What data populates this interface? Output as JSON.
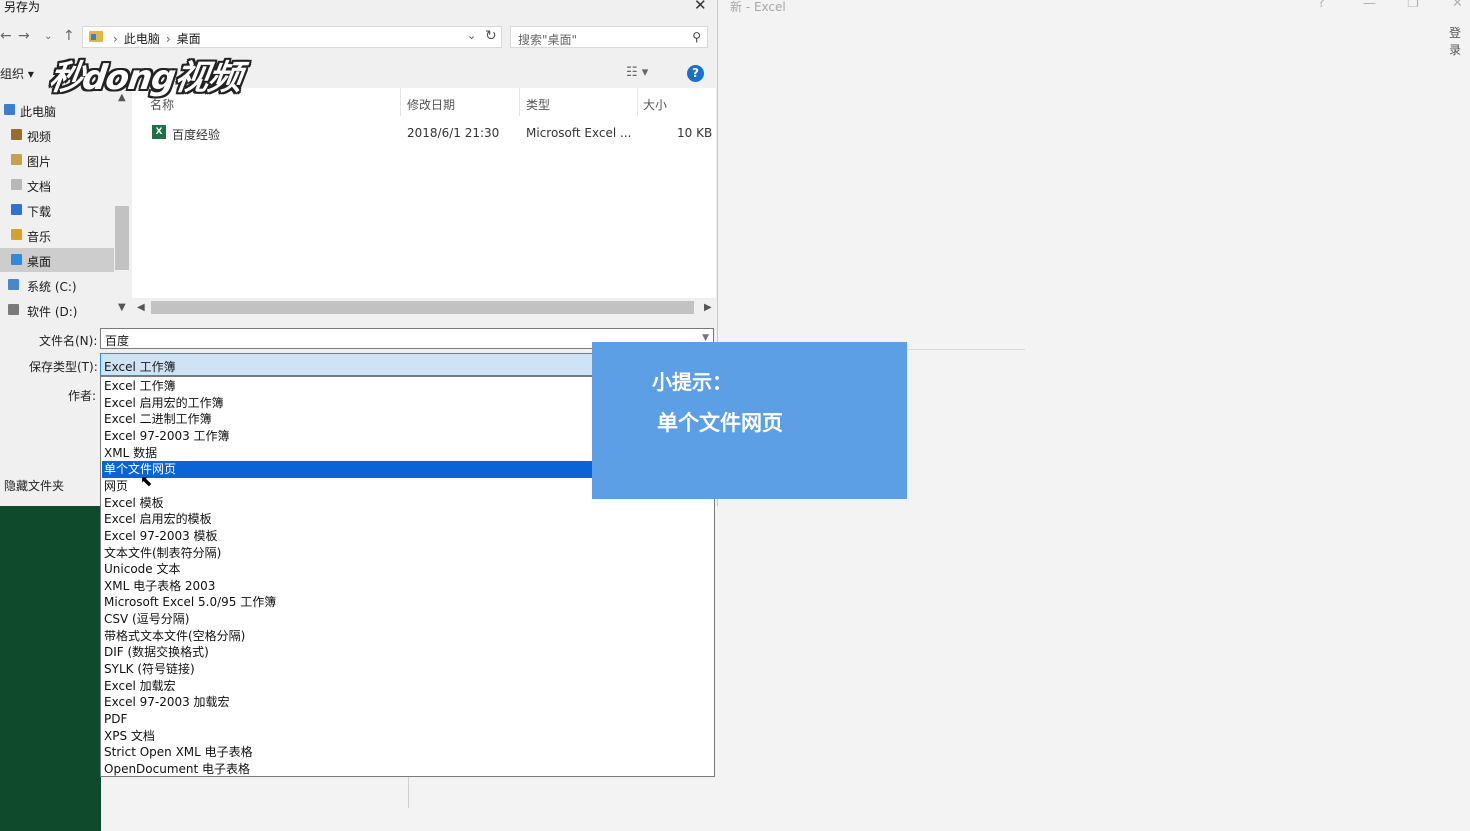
{
  "excel_window": {
    "title": "新 - Excel",
    "login": "登录",
    "help_label": "?"
  },
  "dialog": {
    "title": "另存为",
    "breadcrumb": [
      "此电脑",
      "桌面"
    ],
    "search_placeholder": "搜索\"桌面\"",
    "organize_label": "组织 ▾",
    "help_icon_text": "?",
    "watermark": "秒dong视频",
    "nav_items": [
      {
        "label": "此电脑",
        "icon": "computer-icon",
        "color": "#3d7dd1"
      },
      {
        "label": "视频",
        "icon": "video-folder-icon",
        "color": "#9a6b2a"
      },
      {
        "label": "图片",
        "icon": "pictures-folder-icon",
        "color": "#c8a04e"
      },
      {
        "label": "文档",
        "icon": "documents-folder-icon",
        "color": "#b8b8b8"
      },
      {
        "label": "下载",
        "icon": "downloads-folder-icon",
        "color": "#2c74d1"
      },
      {
        "label": "音乐",
        "icon": "music-folder-icon",
        "color": "#d8a12c"
      },
      {
        "label": "桌面",
        "icon": "desktop-folder-icon",
        "color": "#2c8ae0",
        "selected": true
      },
      {
        "label": "系统 (C:)",
        "icon": "drive-c-icon",
        "color": "#4a86c8"
      },
      {
        "label": "软件 (D:)",
        "icon": "drive-d-icon",
        "color": "#7a7a7a"
      }
    ],
    "columns": [
      "名称",
      "修改日期",
      "类型",
      "大小"
    ],
    "files": [
      {
        "name": "百度经验",
        "modified": "2018/6/1 21:30",
        "type": "Microsoft Excel ...",
        "size": "10 KB",
        "icon": "excel-file-icon"
      }
    ],
    "filename_label": "文件名(N):",
    "filename_value": "百度",
    "savetype_label": "保存类型(T):",
    "savetype_value": "Excel 工作簿",
    "author_label": "作者:",
    "hidden_folders_label": "隐藏文件夹",
    "type_options": [
      "Excel 工作簿",
      "Excel 启用宏的工作簿",
      "Excel 二进制工作簿",
      "Excel 97-2003 工作簿",
      "XML 数据",
      "单个文件网页",
      "网页",
      "Excel 模板",
      "Excel 启用宏的模板",
      "Excel 97-2003 模板",
      "文本文件(制表符分隔)",
      "Unicode 文本",
      "XML 电子表格 2003",
      "Microsoft Excel 5.0/95 工作簿",
      "CSV (逗号分隔)",
      "带格式文本文件(空格分隔)",
      "DIF (数据交换格式)",
      "SYLK (符号链接)",
      "Excel 加载宏",
      "Excel 97-2003 加载宏",
      "PDF",
      "XPS 文档",
      "Strict Open XML 电子表格",
      "OpenDocument 电子表格"
    ],
    "highlighted_option": "单个文件网页"
  },
  "tip": {
    "title": "小提示：",
    "body": "单个文件网页",
    "color": "#5d9fe4"
  },
  "colors": {
    "excel_green": "#0f4a2d",
    "selection_blue": "#0a64d6",
    "combo_bg": "#cfe3f7"
  }
}
